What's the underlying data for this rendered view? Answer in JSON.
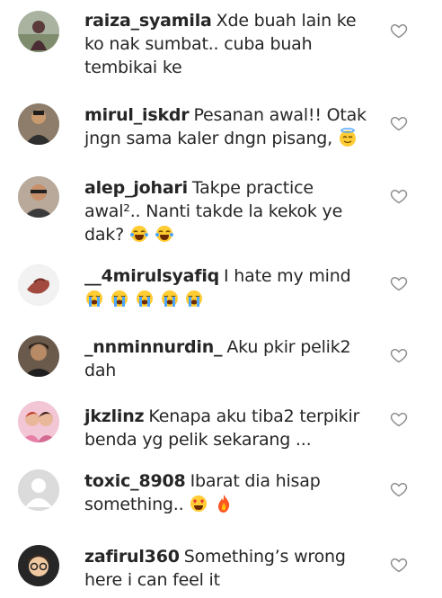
{
  "comments": [
    {
      "username": "raiza_syamila",
      "text": "Xde buah lain ke ko nak sumbat.. cuba buah tembikai ke",
      "emoji": []
    },
    {
      "username": "mirul_iskdr",
      "text": "Pesanan awal!! Otak jngn sama kaler dngn pisang,",
      "emoji": [
        "smiling-face-with-halo"
      ]
    },
    {
      "username": "alep_johari",
      "text": "Takpe practice awal².. Nanti takde la kekok ye dak?",
      "emoji": [
        "tears-of-joy",
        "tears-of-joy"
      ]
    },
    {
      "username": "__4mirulsyafiq",
      "text": "I hate my mind",
      "emoji": [
        "loudly-crying",
        "loudly-crying",
        "loudly-crying",
        "loudly-crying",
        "loudly-crying"
      ]
    },
    {
      "username": "_nnminnurdin_",
      "text": "Aku pkir pelik2 dah",
      "emoji": []
    },
    {
      "username": "jkzlinz",
      "text": "Kenapa aku tiba2 terpikir benda yg pelik sekarang ...",
      "emoji": []
    },
    {
      "username": "toxic_8908",
      "text": "Ibarat dia hisap something..",
      "emoji": [
        "heart-eyes",
        "fire"
      ]
    },
    {
      "username": "zafirul360",
      "text": "Something’s wrong here i can feel it",
      "emoji": []
    }
  ],
  "icons": {
    "like": "heart-outline-icon"
  },
  "colors": {
    "text": "#262626",
    "icon": "#8e8e8e",
    "background": "#ffffff"
  }
}
